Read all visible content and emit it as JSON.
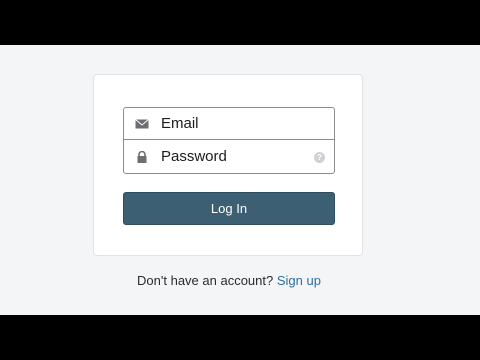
{
  "form": {
    "email_label": "Email",
    "password_label": "Password",
    "help_icon": "?",
    "login_label": "Log In"
  },
  "footer": {
    "prompt": "Don't have an account?",
    "signup_label": "Sign up"
  },
  "colors": {
    "button": "#3d5f73",
    "link": "#2f6f9b",
    "page_background": "#f4f5f7"
  },
  "icons": {
    "email": "envelope-icon",
    "password": "lock-icon",
    "help": "question-circle-icon"
  }
}
